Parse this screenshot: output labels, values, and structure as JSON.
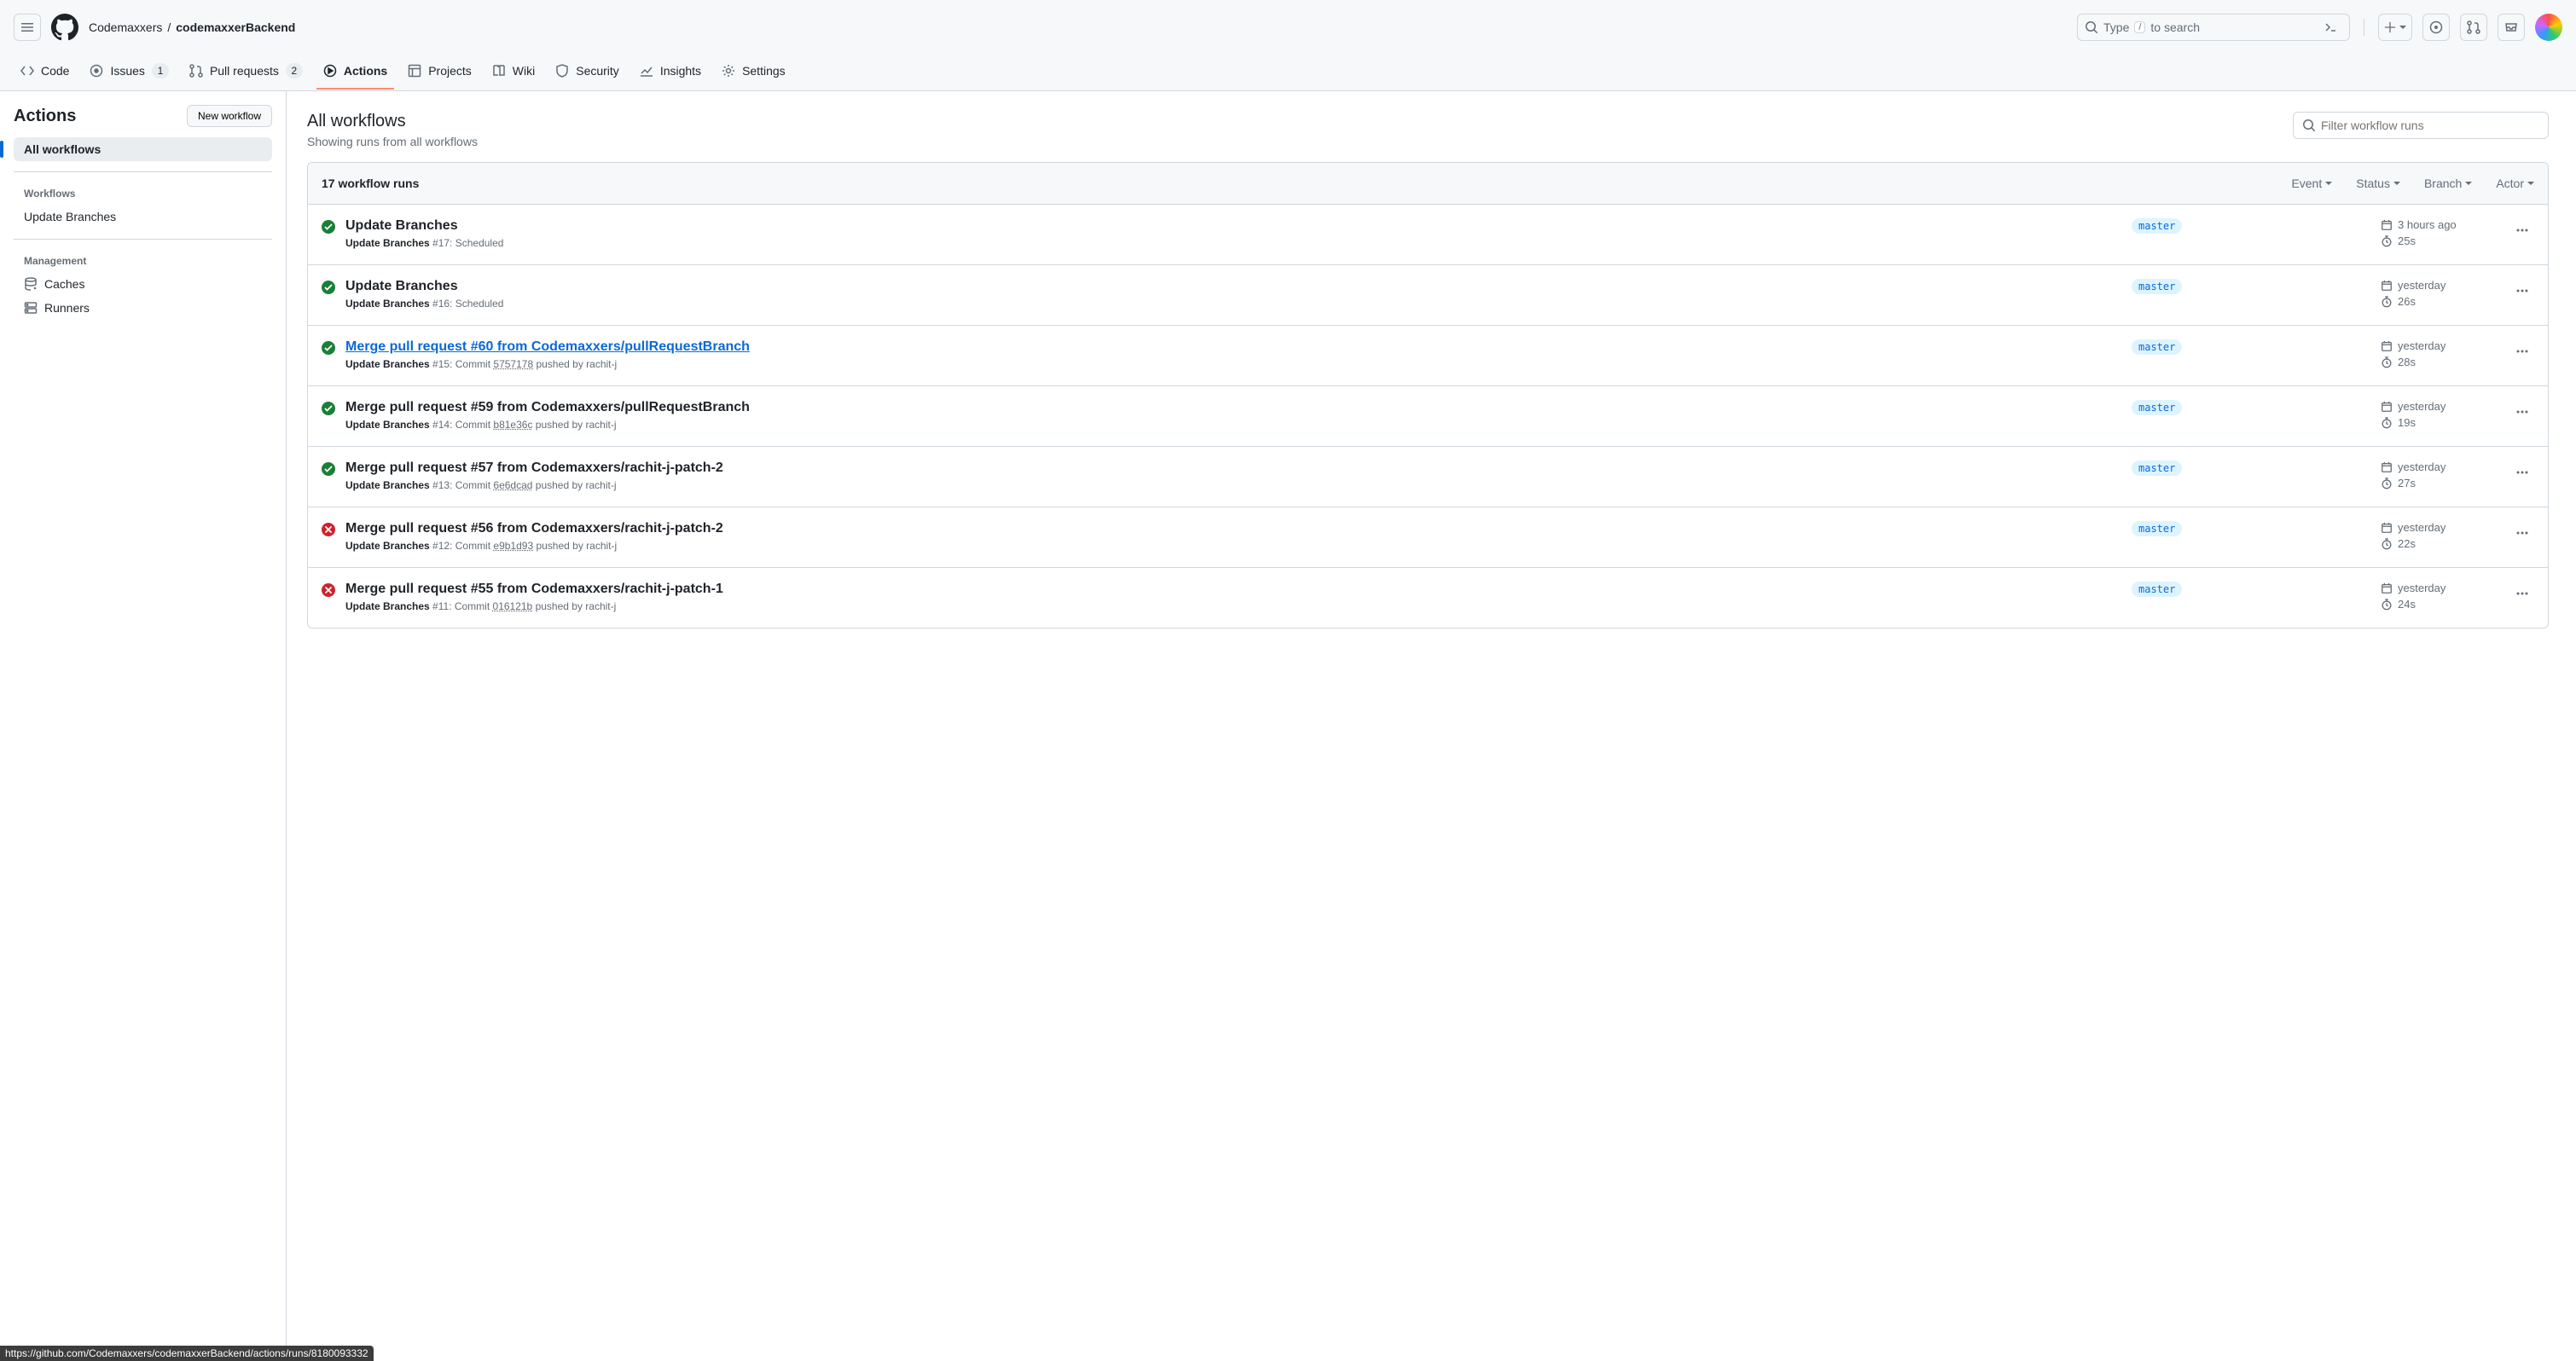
{
  "header": {
    "org": "Codemaxxers",
    "repo": "codemaxxerBackend",
    "search_prefix": "Type",
    "search_suffix": "to search"
  },
  "tabs": {
    "code": "Code",
    "issues": "Issues",
    "issues_count": "1",
    "pulls": "Pull requests",
    "pulls_count": "2",
    "actions": "Actions",
    "projects": "Projects",
    "wiki": "Wiki",
    "security": "Security",
    "insights": "Insights",
    "settings": "Settings"
  },
  "sidebar": {
    "title": "Actions",
    "new_workflow": "New workflow",
    "all": "All workflows",
    "heading_workflows": "Workflows",
    "workflow_item": "Update Branches",
    "heading_mgmt": "Management",
    "caches": "Caches",
    "runners": "Runners"
  },
  "main": {
    "title": "All workflows",
    "subtitle": "Showing runs from all workflows",
    "filter_placeholder": "Filter workflow runs",
    "count": "17 workflow runs",
    "dd_event": "Event",
    "dd_status": "Status",
    "dd_branch": "Branch",
    "dd_actor": "Actor"
  },
  "runs": [
    {
      "status": "success",
      "title": "Update Branches",
      "title_link": false,
      "workflow": "Update Branches",
      "meta_plain": " #17: Scheduled",
      "branch": "master",
      "when": "3 hours ago",
      "duration": "25s"
    },
    {
      "status": "success",
      "title": "Update Branches",
      "title_link": false,
      "workflow": "Update Branches",
      "meta_plain": " #16: Scheduled",
      "branch": "master",
      "when": "yesterday",
      "duration": "26s"
    },
    {
      "status": "success",
      "title": "Merge pull request #60 from Codemaxxers/pullRequestBranch",
      "title_link": true,
      "workflow": "Update Branches",
      "meta_prefix": " #15: Commit ",
      "commit": "5757178",
      "meta_suffix": " pushed by rachit-j",
      "branch": "master",
      "when": "yesterday",
      "duration": "28s"
    },
    {
      "status": "success",
      "title": "Merge pull request #59 from Codemaxxers/pullRequestBranch",
      "title_link": false,
      "workflow": "Update Branches",
      "meta_prefix": " #14: Commit ",
      "commit": "b81e36c",
      "meta_suffix": " pushed by rachit-j",
      "branch": "master",
      "when": "yesterday",
      "duration": "19s"
    },
    {
      "status": "success",
      "title": "Merge pull request #57 from Codemaxxers/rachit-j-patch-2",
      "title_link": false,
      "workflow": "Update Branches",
      "meta_prefix": " #13: Commit ",
      "commit": "6e6dcad",
      "meta_suffix": " pushed by rachit-j",
      "branch": "master",
      "when": "yesterday",
      "duration": "27s"
    },
    {
      "status": "failure",
      "title": "Merge pull request #56 from Codemaxxers/rachit-j-patch-2",
      "title_link": false,
      "workflow": "Update Branches",
      "meta_prefix": " #12: Commit ",
      "commit": "e9b1d93",
      "meta_suffix": " pushed by rachit-j",
      "branch": "master",
      "when": "yesterday",
      "duration": "22s"
    },
    {
      "status": "failure",
      "title": "Merge pull request #55 from Codemaxxers/rachit-j-patch-1",
      "title_link": false,
      "workflow": "Update Branches",
      "meta_prefix": " #11: Commit ",
      "commit": "016121b",
      "meta_suffix": " pushed by rachit-j",
      "branch": "master",
      "when": "yesterday",
      "duration": "24s"
    }
  ],
  "status_bar": "https://github.com/Codemaxxers/codemaxxerBackend/actions/runs/8180093332"
}
